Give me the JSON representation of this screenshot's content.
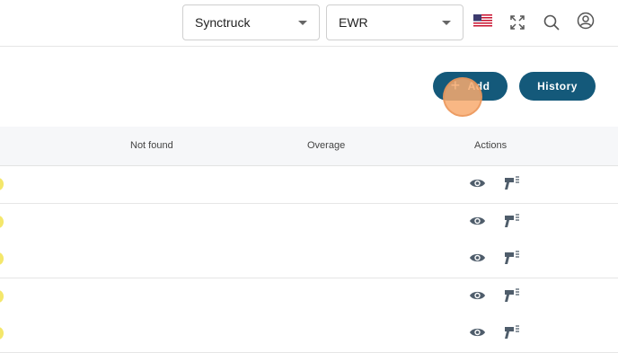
{
  "toolbar": {
    "company_select": {
      "value": "Synctruck"
    },
    "station_select": {
      "value": "EWR"
    },
    "icons": [
      "us-flag-icon",
      "fullscreen-icon",
      "search-icon",
      "user-icon"
    ]
  },
  "actions": {
    "add_label": "Add",
    "history_label": "History"
  },
  "table": {
    "columns": [
      "Not found",
      "Overage",
      "Actions"
    ],
    "rows": [
      {
        "status_color": "#f4e76b",
        "actions": [
          "eye-icon",
          "scanner-icon"
        ]
      },
      {
        "status_color": "#f4e76b",
        "actions": [
          "eye-icon",
          "scanner-icon"
        ]
      },
      {
        "status_color": "#f4e76b",
        "actions": [
          "eye-icon",
          "scanner-icon"
        ]
      },
      {
        "status_color": "#f4e76b",
        "actions": [
          "eye-icon",
          "scanner-icon"
        ]
      },
      {
        "status_color": "#f4e76b",
        "actions": [
          "eye-icon",
          "scanner-icon"
        ]
      }
    ]
  },
  "colors": {
    "primary": "#14597a",
    "header_bg": "#f6f7f9",
    "status_yellow": "#f4e76b"
  }
}
